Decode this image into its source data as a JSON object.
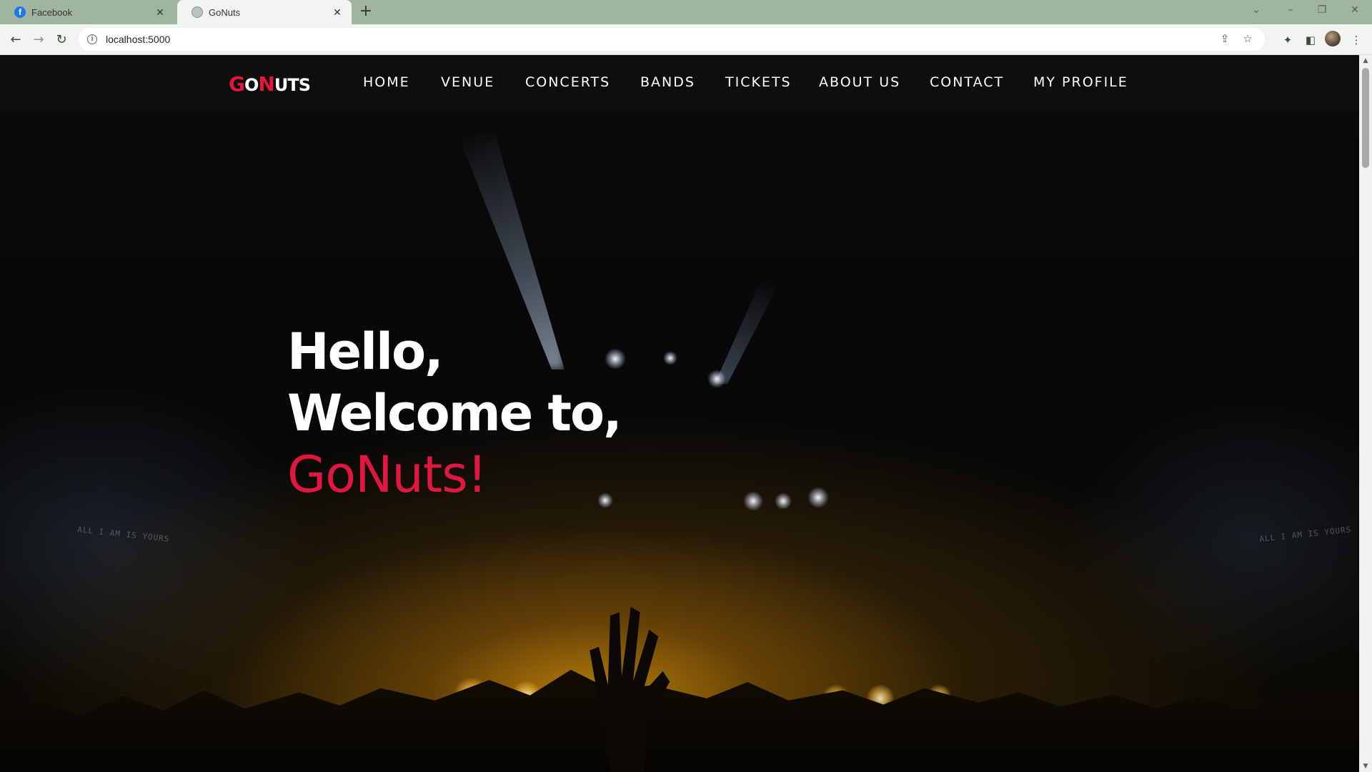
{
  "browser": {
    "tabs": [
      {
        "title": "Facebook",
        "favicon": "facebook-icon",
        "active": false
      },
      {
        "title": "GoNuts",
        "favicon": "globe-icon",
        "active": true
      }
    ],
    "new_tab_label": "+",
    "address": "localhost:5000"
  },
  "site": {
    "logo": {
      "g": "G",
      "o": "O",
      "n": "N",
      "uts": "UTS"
    },
    "nav": [
      {
        "label": "HOME"
      },
      {
        "label": "VENUE"
      },
      {
        "label": "CONCERTS"
      },
      {
        "label": "BANDS"
      },
      {
        "label": "TICKETS"
      },
      {
        "label": "ABOUT US"
      },
      {
        "label": "CONTACT"
      },
      {
        "label": "MY PROFILE"
      }
    ]
  },
  "hero": {
    "line1": "Hello,",
    "line2": "Welcome to,",
    "brand": "GoNuts!"
  },
  "background": {
    "stage_text_left": "ALL I AM IS YOURS",
    "stage_text_right": "ALL I AM IS YOURS"
  },
  "colors": {
    "accent": "#e1173f",
    "nav_text": "#ffffff",
    "chrome": "#9fb5a0"
  }
}
